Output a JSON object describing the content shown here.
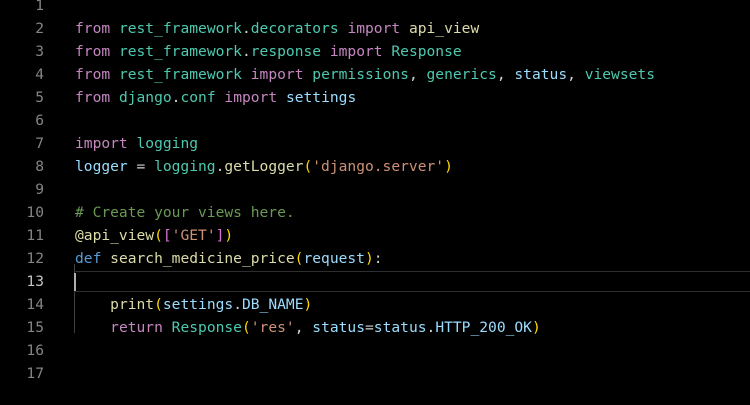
{
  "colors": {
    "background": "#000000",
    "keyword": "#c586c0",
    "module": "#4ec9b0",
    "def_keyword": "#569cd6",
    "function": "#dcdcaa",
    "variable": "#9cdcfe",
    "string": "#ce9178",
    "comment": "#6a9955",
    "line_number": "#858585"
  },
  "editor": {
    "current_line": 13,
    "lines": [
      {
        "num": "1",
        "tokens": []
      },
      {
        "num": "2",
        "tokens": [
          {
            "t": "from",
            "c": "kw"
          },
          {
            "t": " ",
            "c": "punc"
          },
          {
            "t": "rest_framework",
            "c": "mod"
          },
          {
            "t": ".",
            "c": "punc"
          },
          {
            "t": "decorators",
            "c": "mod"
          },
          {
            "t": " ",
            "c": "punc"
          },
          {
            "t": "import",
            "c": "kw"
          },
          {
            "t": " ",
            "c": "punc"
          },
          {
            "t": "api_view",
            "c": "fn"
          }
        ]
      },
      {
        "num": "3",
        "tokens": [
          {
            "t": "from",
            "c": "kw"
          },
          {
            "t": " ",
            "c": "punc"
          },
          {
            "t": "rest_framework",
            "c": "mod"
          },
          {
            "t": ".",
            "c": "punc"
          },
          {
            "t": "response",
            "c": "mod"
          },
          {
            "t": " ",
            "c": "punc"
          },
          {
            "t": "import",
            "c": "kw"
          },
          {
            "t": " ",
            "c": "punc"
          },
          {
            "t": "Response",
            "c": "mod"
          }
        ]
      },
      {
        "num": "4",
        "tokens": [
          {
            "t": "from",
            "c": "kw"
          },
          {
            "t": " ",
            "c": "punc"
          },
          {
            "t": "rest_framework",
            "c": "mod"
          },
          {
            "t": " ",
            "c": "punc"
          },
          {
            "t": "import",
            "c": "kw"
          },
          {
            "t": " ",
            "c": "punc"
          },
          {
            "t": "permissions",
            "c": "mod"
          },
          {
            "t": ", ",
            "c": "punc"
          },
          {
            "t": "generics",
            "c": "mod"
          },
          {
            "t": ", ",
            "c": "punc"
          },
          {
            "t": "status",
            "c": "var"
          },
          {
            "t": ", ",
            "c": "punc"
          },
          {
            "t": "viewsets",
            "c": "mod"
          }
        ]
      },
      {
        "num": "5",
        "tokens": [
          {
            "t": "from",
            "c": "kw"
          },
          {
            "t": " ",
            "c": "punc"
          },
          {
            "t": "django",
            "c": "mod"
          },
          {
            "t": ".",
            "c": "punc"
          },
          {
            "t": "conf",
            "c": "mod"
          },
          {
            "t": " ",
            "c": "punc"
          },
          {
            "t": "import",
            "c": "kw"
          },
          {
            "t": " ",
            "c": "punc"
          },
          {
            "t": "settings",
            "c": "var"
          }
        ]
      },
      {
        "num": "6",
        "tokens": []
      },
      {
        "num": "7",
        "tokens": [
          {
            "t": "import",
            "c": "kw"
          },
          {
            "t": " ",
            "c": "punc"
          },
          {
            "t": "logging",
            "c": "mod"
          }
        ]
      },
      {
        "num": "8",
        "tokens": [
          {
            "t": "logger",
            "c": "var"
          },
          {
            "t": " = ",
            "c": "punc"
          },
          {
            "t": "logging",
            "c": "mod"
          },
          {
            "t": ".",
            "c": "punc"
          },
          {
            "t": "getLogger",
            "c": "fn"
          },
          {
            "t": "(",
            "c": "br1"
          },
          {
            "t": "'django.server'",
            "c": "str"
          },
          {
            "t": ")",
            "c": "br1"
          }
        ]
      },
      {
        "num": "9",
        "tokens": []
      },
      {
        "num": "10",
        "tokens": [
          {
            "t": "# Create your views here.",
            "c": "cmt"
          }
        ]
      },
      {
        "num": "11",
        "tokens": [
          {
            "t": "@api_view",
            "c": "dec"
          },
          {
            "t": "(",
            "c": "br1"
          },
          {
            "t": "[",
            "c": "br2"
          },
          {
            "t": "'GET'",
            "c": "str"
          },
          {
            "t": "]",
            "c": "br2"
          },
          {
            "t": ")",
            "c": "br1"
          }
        ]
      },
      {
        "num": "12",
        "tokens": [
          {
            "t": "def",
            "c": "def"
          },
          {
            "t": " ",
            "c": "punc"
          },
          {
            "t": "search_medicine_price",
            "c": "fn"
          },
          {
            "t": "(",
            "c": "br1"
          },
          {
            "t": "request",
            "c": "var"
          },
          {
            "t": ")",
            "c": "br1"
          },
          {
            "t": ":",
            "c": "punc"
          }
        ]
      },
      {
        "num": "13",
        "tokens": []
      },
      {
        "num": "14",
        "tokens": [
          {
            "t": "    ",
            "c": "punc"
          },
          {
            "t": "print",
            "c": "fn"
          },
          {
            "t": "(",
            "c": "br1"
          },
          {
            "t": "settings",
            "c": "var"
          },
          {
            "t": ".",
            "c": "punc"
          },
          {
            "t": "DB_NAME",
            "c": "var"
          },
          {
            "t": ")",
            "c": "br1"
          }
        ]
      },
      {
        "num": "15",
        "tokens": [
          {
            "t": "    ",
            "c": "punc"
          },
          {
            "t": "return",
            "c": "kw"
          },
          {
            "t": " ",
            "c": "punc"
          },
          {
            "t": "Response",
            "c": "mod"
          },
          {
            "t": "(",
            "c": "br1"
          },
          {
            "t": "'res'",
            "c": "str"
          },
          {
            "t": ", ",
            "c": "punc"
          },
          {
            "t": "status",
            "c": "var"
          },
          {
            "t": "=",
            "c": "punc"
          },
          {
            "t": "status",
            "c": "var"
          },
          {
            "t": ".",
            "c": "punc"
          },
          {
            "t": "HTTP_200_OK",
            "c": "var"
          },
          {
            "t": ")",
            "c": "br1"
          }
        ]
      },
      {
        "num": "16",
        "tokens": []
      },
      {
        "num": "17",
        "tokens": []
      }
    ]
  }
}
